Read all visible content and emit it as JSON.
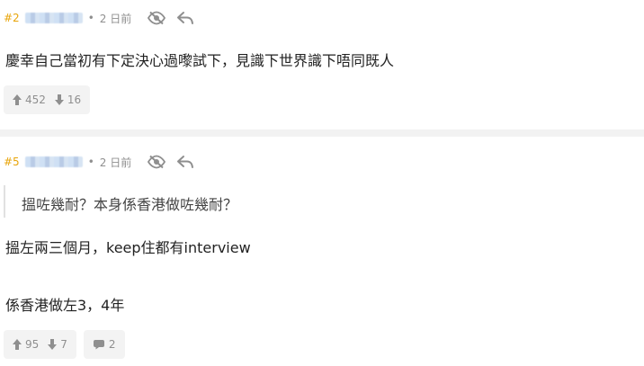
{
  "posts": [
    {
      "number": "#2",
      "dot": "•",
      "time": "2 日前",
      "content": "慶幸自己當初有下定決心過嚟試下，見識下世界識下唔同既人",
      "upvotes": "452",
      "downvotes": "16"
    },
    {
      "number": "#5",
      "dot": "•",
      "time": "2 日前",
      "quote": "搵咗幾耐？本身係香港做咗幾耐？",
      "content_line1": "搵左兩三個月，keep住都有interview",
      "content_line2": "係香港做左3，4年",
      "upvotes": "95",
      "downvotes": "7",
      "replies": "2"
    }
  ],
  "colors": {
    "post_number": "#e8a50b",
    "meta_text": "#8f8f8f",
    "button_bg": "#f3f3f3",
    "divider": "#f2f2f2"
  }
}
